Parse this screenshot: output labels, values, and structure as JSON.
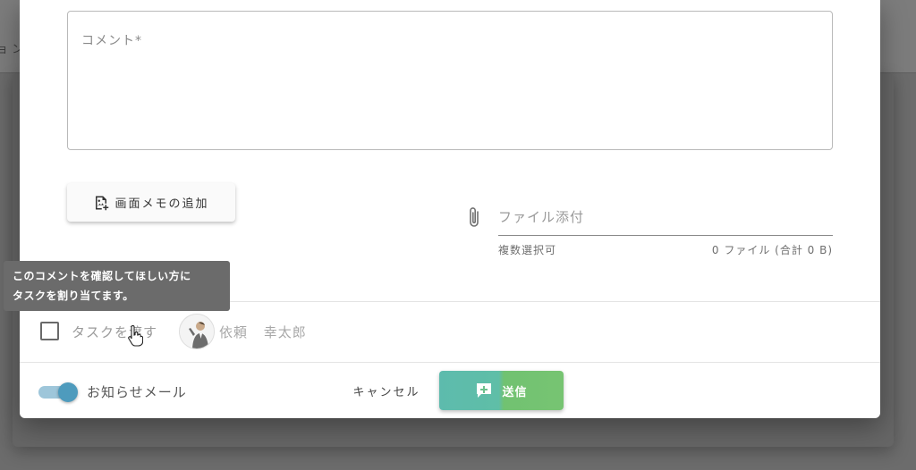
{
  "background": {
    "topbar_fragment": "ョ ン"
  },
  "dialog": {
    "comment": {
      "label": "コメント*",
      "value": ""
    },
    "memo_button": {
      "label": "画面メモの追加",
      "icon": "image-add-icon"
    },
    "attachment": {
      "icon": "paperclip-icon",
      "placeholder": "ファイル添付",
      "hint": "複数選択可",
      "count": "0 ファイル (合計 0 B)"
    },
    "task": {
      "checkbox_checked": false,
      "label": "タスクを渡す",
      "assignee": "依頼 幸太郎",
      "avatar_icon": "person-avatar-icon"
    },
    "notify": {
      "label": "お知らせメール",
      "enabled": true
    },
    "actions": {
      "cancel_label": "キャンセル",
      "send_label": "送信",
      "send_icon": "comment-add-icon"
    },
    "tooltip": {
      "line1": "このコメントを確認してほしい方に",
      "line2": "タスクを割り当てます。"
    }
  },
  "colors": {
    "send_gradient_start": "#5dbbad",
    "send_gradient_end": "#77c472",
    "toggle_thumb": "#4e9bbd",
    "toggle_track": "#9ec6da",
    "overlay": "#6c6c6c"
  }
}
